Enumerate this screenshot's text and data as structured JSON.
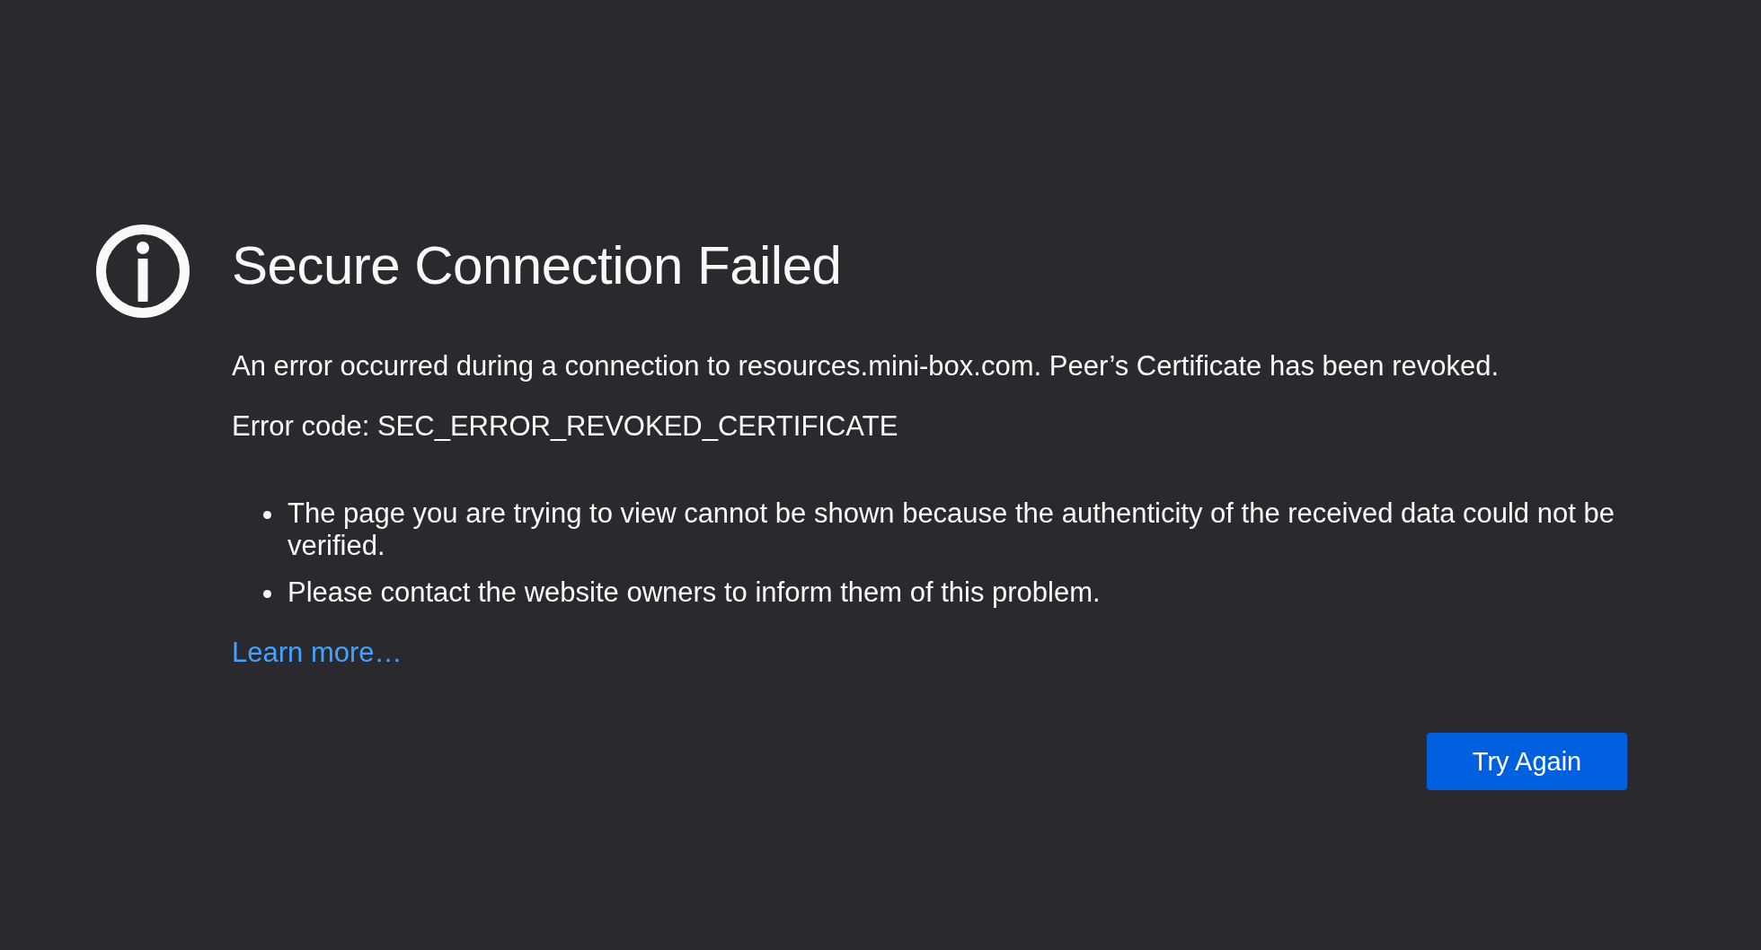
{
  "title": "Secure Connection Failed",
  "message": "An error occurred during a connection to resources.mini-box.com. Peer’s Certificate has been revoked.",
  "error_code": "Error code: SEC_ERROR_REVOKED_CERTIFICATE",
  "details": [
    "The page you are trying to view cannot be shown because the authenticity of the received data could not be verified.",
    "Please contact the website owners to inform them of this problem."
  ],
  "learn_more_link": "Learn more…",
  "buttons": [
    {
      "label": "Try Again"
    }
  ]
}
